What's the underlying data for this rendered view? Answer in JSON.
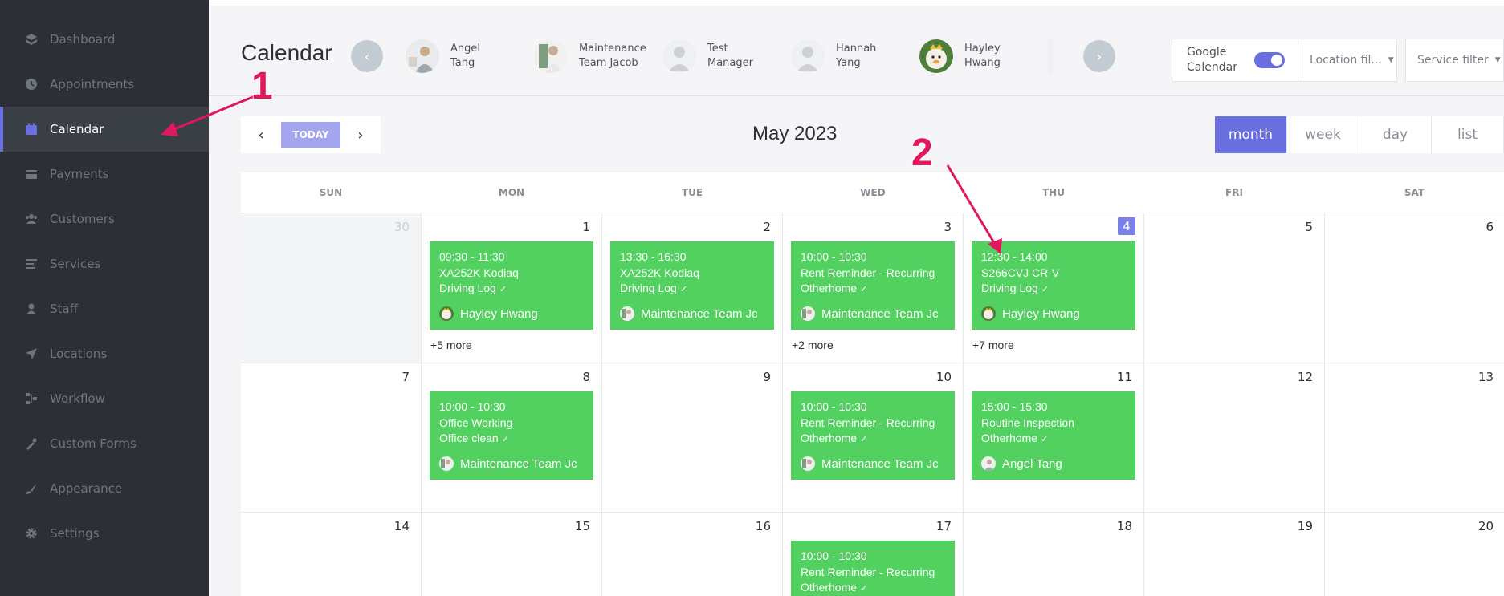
{
  "sidebar": {
    "items": [
      {
        "label": "Dashboard",
        "icon": "dashboard-icon"
      },
      {
        "label": "Appointments",
        "icon": "clock-icon"
      },
      {
        "label": "Calendar",
        "icon": "calendar-icon",
        "active": true
      },
      {
        "label": "Payments",
        "icon": "wallet-icon"
      },
      {
        "label": "Customers",
        "icon": "users-icon"
      },
      {
        "label": "Services",
        "icon": "list-icon"
      },
      {
        "label": "Staff",
        "icon": "person-icon"
      },
      {
        "label": "Locations",
        "icon": "location-arrow-icon"
      },
      {
        "label": "Workflow",
        "icon": "workflow-icon"
      },
      {
        "label": "Custom Forms",
        "icon": "forms-icon"
      },
      {
        "label": "Appearance",
        "icon": "brush-icon"
      },
      {
        "label": "Settings",
        "icon": "gear-icon"
      }
    ]
  },
  "header": {
    "title": "Calendar",
    "staff": [
      {
        "line1": "Angel",
        "line2": "Tang"
      },
      {
        "line1": "Maintenance",
        "line2": "Team Jacob"
      },
      {
        "line1": "Test",
        "line2": "Manager"
      },
      {
        "line1": "Hannah",
        "line2": "Yang"
      },
      {
        "line1": "Hayley",
        "line2": "Hwang"
      }
    ],
    "google_calendar": {
      "line1": "Google",
      "line2": "Calendar",
      "enabled": true
    },
    "location_filter": "Location fil...",
    "service_filter": "Service filter"
  },
  "toolbar": {
    "today_label": "TODAY",
    "month_title": "May 2023",
    "views": [
      "month",
      "week",
      "day",
      "list"
    ],
    "active_view": "month"
  },
  "calendar": {
    "weekdays": [
      "SUN",
      "MON",
      "TUE",
      "WED",
      "THU",
      "FRI",
      "SAT"
    ],
    "weeks": [
      [
        "30",
        "1",
        "2",
        "3",
        "4",
        "5",
        "6"
      ],
      [
        "7",
        "8",
        "9",
        "10",
        "11",
        "12",
        "13"
      ],
      [
        "14",
        "15",
        "16",
        "17",
        "18",
        "19",
        "20"
      ]
    ],
    "today": "4",
    "events": [
      {
        "time": "09:30 - 11:30",
        "title": "XA252K Kodiaq",
        "subtitle": "Driving Log",
        "staff": "Hayley Hwang"
      },
      {
        "time": "13:30 - 16:30",
        "title": "XA252K Kodiaq",
        "subtitle": "Driving Log",
        "staff": "Maintenance Team Jc"
      },
      {
        "time": "10:00 - 10:30",
        "title": "Rent Reminder - Recurring",
        "subtitle": "Otherhome",
        "staff": "Maintenance Team Jc"
      },
      {
        "time": "12:30 - 14:00",
        "title": "S266CVJ CR-V",
        "subtitle": "Driving Log",
        "staff": "Hayley Hwang"
      },
      {
        "time": "10:00 - 10:30",
        "title": "Office Working",
        "subtitle": "Office clean",
        "staff": "Maintenance Team Jc"
      },
      {
        "time": "10:00 - 10:30",
        "title": "Rent Reminder - Recurring",
        "subtitle": "Otherhome",
        "staff": "Maintenance Team Jc"
      },
      {
        "time": "15:00 - 15:30",
        "title": "Routine Inspection",
        "subtitle": "Otherhome",
        "staff": "Angel Tang"
      },
      {
        "time": "10:00 - 10:30",
        "title": "Rent Reminder - Recurring",
        "subtitle": "Otherhome",
        "staff": ""
      }
    ],
    "more_links": [
      "+5 more",
      "+2 more",
      "+7 more"
    ]
  },
  "annotations": [
    "1",
    "2"
  ],
  "colors": {
    "sidebar_bg": "#2c3036",
    "accent": "#6a6fe0",
    "event_green": "#53d160",
    "annotation": "#e2185f"
  }
}
